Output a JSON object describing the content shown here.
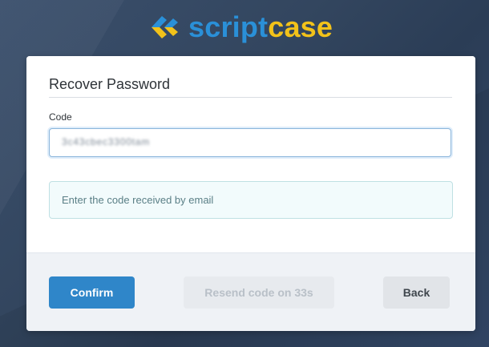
{
  "brand": {
    "name_part1": "script",
    "name_part2": "case",
    "colors": {
      "blue": "#2a90d8",
      "yellow": "#f2c21a"
    }
  },
  "form": {
    "title": "Recover Password",
    "code_label": "Code",
    "code_value": "3c43cbec3300tam",
    "hint": "Enter the code received by email"
  },
  "actions": {
    "confirm_label": "Confirm",
    "resend_label": "Resend code on 33s",
    "back_label": "Back"
  },
  "colors": {
    "primary_button": "#2f86c9",
    "background": "#34486a",
    "hint_background": "#f2fbfc"
  }
}
